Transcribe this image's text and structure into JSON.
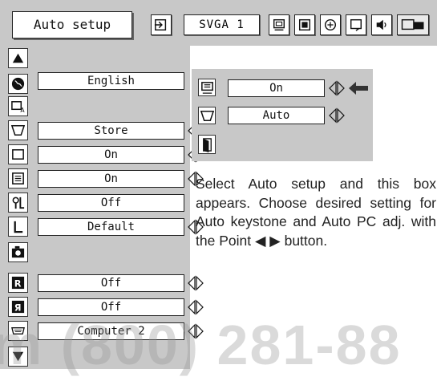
{
  "header": {
    "menu_title": "Auto setup",
    "mode_label": "SVGA 1",
    "icons": [
      "input-icon",
      "pc-adjust-icon",
      "image-select-icon",
      "image-adjust-icon",
      "screen-icon",
      "sound-icon",
      "setting-icon"
    ],
    "active_icon": "setting-icon"
  },
  "settings_menu": {
    "items": [
      {
        "icon": "scroll-up-icon",
        "value": null
      },
      {
        "icon": "language-globe-icon",
        "value": "English"
      },
      {
        "icon": "auto-setup-icon",
        "value": null
      },
      {
        "icon": "keystone-icon",
        "value": "Store"
      },
      {
        "icon": "blue-back-icon",
        "value": "On"
      },
      {
        "icon": "display-icon",
        "value": "On"
      },
      {
        "icon": "logo-icon",
        "value": "Off"
      },
      {
        "icon": "ceiling-icon",
        "value": "Default"
      },
      {
        "icon": "camera-icon",
        "value": null
      },
      {
        "icon": "rear-icon",
        "value": "Off"
      },
      {
        "icon": "reverse-icon",
        "value": "Off"
      },
      {
        "icon": "terminal-icon",
        "value": "Computer 2"
      },
      {
        "icon": "scroll-down-icon",
        "value": null
      }
    ]
  },
  "auto_setup_box": {
    "auto_keystone_value": "On",
    "auto_pc_adj_value": "Auto"
  },
  "description": "Select Auto setup and this box appears. Choose desired setting for Auto keystone and Auto PC adj. with the Point ◀ ▶ button.",
  "watermark": "m (800) 281-88"
}
